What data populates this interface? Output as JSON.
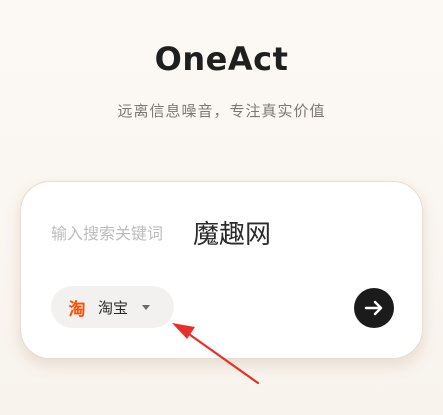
{
  "header": {
    "brand": "OneAct",
    "tagline": "远离信息噪音，专注真实价值"
  },
  "search": {
    "placeholder": "输入搜索关键词",
    "value": "",
    "source": {
      "icon_glyph": "淘",
      "icon_color": "#ff5000",
      "label": "淘宝",
      "icon": "taobao-icon",
      "dropdown_icon": "caret-down-icon"
    },
    "submit_icon": "arrow-right-icon"
  },
  "watermark": "魔趣网",
  "colors": {
    "background": "#fbf7f2",
    "card": "#ffffff",
    "submit_button": "#1b1b1b",
    "annotation_arrow": "#e8302a"
  }
}
